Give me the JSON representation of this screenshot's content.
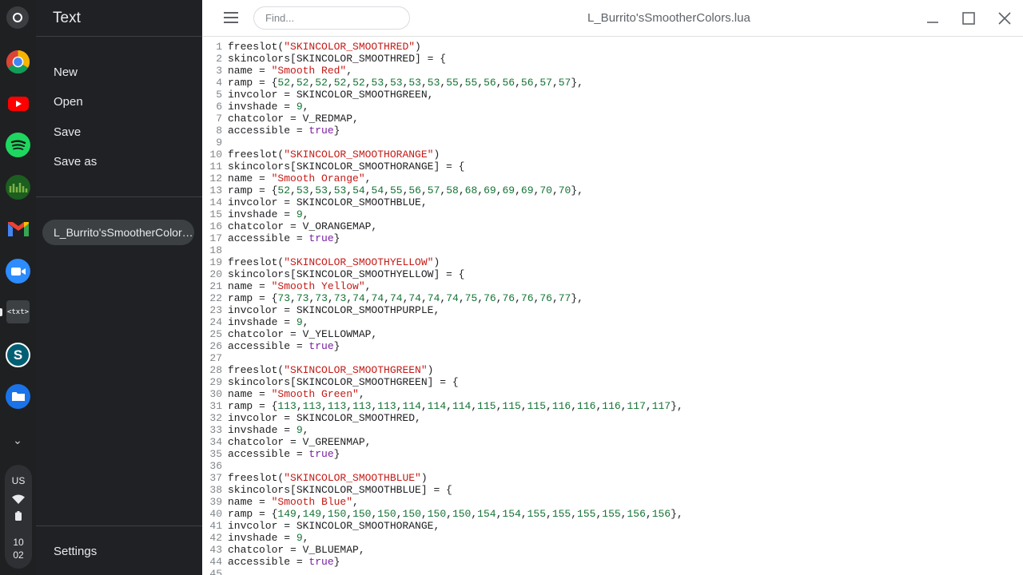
{
  "app": {
    "drawer_title": "Text",
    "menu": [
      "New",
      "Open",
      "Save",
      "Save as"
    ],
    "open_file": "L_Burrito'sSmootherColors.lua",
    "settings_label": "Settings"
  },
  "search": {
    "placeholder": "Find..."
  },
  "window": {
    "title": "L_Burrito'sSmootherColors.lua"
  },
  "shelf": {
    "apps": [
      "chrome-icon",
      "youtube-icon",
      "spotify-icon",
      "green-app-icon",
      "gmail-icon",
      "zoom-icon",
      "text-app-icon",
      "s-app-icon",
      "files-icon"
    ],
    "tray": {
      "lang": "US",
      "time_hour": "10",
      "time_min": "02"
    }
  },
  "colors": {
    "string": "#c41a16",
    "number": "#137333",
    "keyword": "#7b1fa2"
  },
  "code_lines": [
    "freeslot(\"SKINCOLOR_SMOOTHRED\")",
    "skincolors[SKINCOLOR_SMOOTHRED] = {",
    "name = \"Smooth Red\",",
    "ramp = {52,52,52,52,52,53,53,53,53,55,55,56,56,56,57,57},",
    "invcolor = SKINCOLOR_SMOOTHGREEN,",
    "invshade = 9,",
    "chatcolor = V_REDMAP,",
    "accessible = true}",
    "",
    "freeslot(\"SKINCOLOR_SMOOTHORANGE\")",
    "skincolors[SKINCOLOR_SMOOTHORANGE] = {",
    "name = \"Smooth Orange\",",
    "ramp = {52,53,53,53,54,54,55,56,57,58,68,69,69,69,70,70},",
    "invcolor = SKINCOLOR_SMOOTHBLUE,",
    "invshade = 9,",
    "chatcolor = V_ORANGEMAP,",
    "accessible = true}",
    "",
    "freeslot(\"SKINCOLOR_SMOOTHYELLOW\")",
    "skincolors[SKINCOLOR_SMOOTHYELLOW] = {",
    "name = \"Smooth Yellow\",",
    "ramp = {73,73,73,73,74,74,74,74,74,74,75,76,76,76,76,77},",
    "invcolor = SKINCOLOR_SMOOTHPURPLE,",
    "invshade = 9,",
    "chatcolor = V_YELLOWMAP,",
    "accessible = true}",
    "",
    "freeslot(\"SKINCOLOR_SMOOTHGREEN\")",
    "skincolors[SKINCOLOR_SMOOTHGREEN] = {",
    "name = \"Smooth Green\",",
    "ramp = {113,113,113,113,113,114,114,114,115,115,115,116,116,116,117,117},",
    "invcolor = SKINCOLOR_SMOOTHRED,",
    "invshade = 9,",
    "chatcolor = V_GREENMAP,",
    "accessible = true}",
    "",
    "freeslot(\"SKINCOLOR_SMOOTHBLUE\")",
    "skincolors[SKINCOLOR_SMOOTHBLUE] = {",
    "name = \"Smooth Blue\",",
    "ramp = {149,149,150,150,150,150,150,150,154,154,155,155,155,155,156,156},",
    "invcolor = SKINCOLOR_SMOOTHORANGE,",
    "invshade = 9,",
    "chatcolor = V_BLUEMAP,",
    "accessible = true}",
    ""
  ]
}
